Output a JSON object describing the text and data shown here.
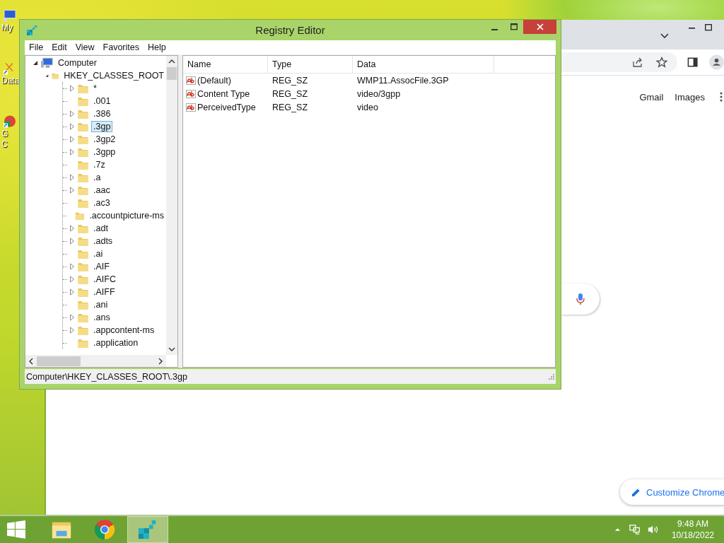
{
  "desktop_icons": [
    {
      "lines": [
        "My"
      ]
    },
    {
      "lines": [
        "Data"
      ]
    },
    {
      "lines": [
        "G",
        "C"
      ]
    }
  ],
  "browser": {
    "links": [
      "Gmail",
      "Images"
    ],
    "customize_button": "Customize Chrome"
  },
  "window": {
    "title": "Registry Editor",
    "menu": [
      "File",
      "Edit",
      "View",
      "Favorites",
      "Help"
    ],
    "tree": {
      "label": "Computer",
      "expanded": true,
      "children": [
        {
          "label": "HKEY_CLASSES_ROOT",
          "expanded": true,
          "children": [
            {
              "label": "*",
              "expandable": true,
              "selected": false
            },
            {
              "label": ".001",
              "expandable": false,
              "selected": false
            },
            {
              "label": ".386",
              "expandable": true,
              "selected": false
            },
            {
              "label": ".3gp",
              "expandable": true,
              "selected": true
            },
            {
              "label": ".3gp2",
              "expandable": true,
              "selected": false
            },
            {
              "label": ".3gpp",
              "expandable": true,
              "selected": false
            },
            {
              "label": ".7z",
              "expandable": false,
              "selected": false
            },
            {
              "label": ".a",
              "expandable": true,
              "selected": false
            },
            {
              "label": ".aac",
              "expandable": true,
              "selected": false
            },
            {
              "label": ".ac3",
              "expandable": false,
              "selected": false
            },
            {
              "label": ".accountpicture-ms",
              "expandable": false,
              "selected": false
            },
            {
              "label": ".adt",
              "expandable": true,
              "selected": false
            },
            {
              "label": ".adts",
              "expandable": true,
              "selected": false
            },
            {
              "label": ".ai",
              "expandable": false,
              "selected": false
            },
            {
              "label": ".AIF",
              "expandable": true,
              "selected": false
            },
            {
              "label": ".AIFC",
              "expandable": true,
              "selected": false
            },
            {
              "label": ".AIFF",
              "expandable": true,
              "selected": false
            },
            {
              "label": ".ani",
              "expandable": false,
              "selected": false
            },
            {
              "label": ".ans",
              "expandable": true,
              "selected": false
            },
            {
              "label": ".appcontent-ms",
              "expandable": true,
              "selected": false
            },
            {
              "label": ".application",
              "expandable": false,
              "selected": false
            }
          ]
        }
      ]
    },
    "columns": [
      "Name",
      "Type",
      "Data"
    ],
    "values": [
      {
        "name": "(Default)",
        "type": "REG_SZ",
        "data": "WMP11.AssocFile.3GP"
      },
      {
        "name": "Content Type",
        "type": "REG_SZ",
        "data": "video/3gpp"
      },
      {
        "name": "PerceivedType",
        "type": "REG_SZ",
        "data": "video"
      }
    ],
    "status_bar": "Computer\\HKEY_CLASSES_ROOT\\.3gp"
  },
  "taskbar": {
    "apps": [
      {
        "kind": "explorer",
        "selected": false
      },
      {
        "kind": "chrome",
        "selected": false
      },
      {
        "kind": "registry",
        "selected": true
      }
    ],
    "time": "9:48 AM",
    "date": "10/18/2022"
  }
}
